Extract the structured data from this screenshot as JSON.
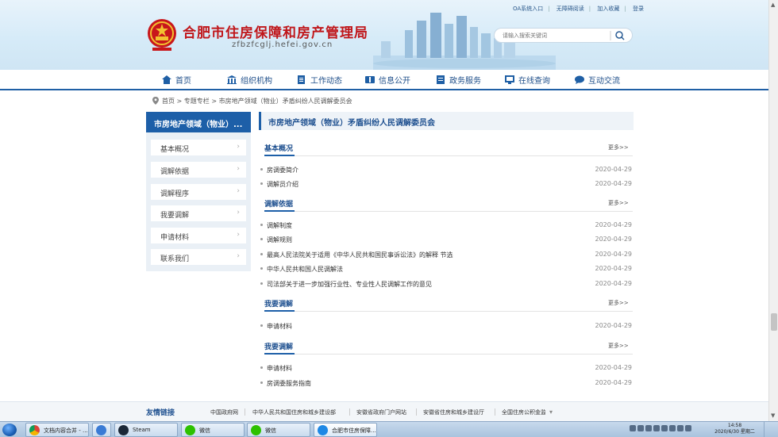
{
  "header": {
    "site_title": "合肥市住房保障和房产管理局",
    "site_domain": "zfbzfcglj.hefei.gov.cn",
    "top_links": [
      "OA系统入口",
      "无障碍阅读",
      "加入收藏",
      "登录"
    ],
    "search_placeholder": "请输入搜索关键词"
  },
  "nav": {
    "items": [
      {
        "label": "首页",
        "icon": "home-icon"
      },
      {
        "label": "组织机构",
        "icon": "building-icon"
      },
      {
        "label": "工作动态",
        "icon": "document-icon"
      },
      {
        "label": "信息公开",
        "icon": "info-icon"
      },
      {
        "label": "政务服务",
        "icon": "service-icon"
      },
      {
        "label": "在线查询",
        "icon": "query-icon"
      },
      {
        "label": "互动交流",
        "icon": "chat-icon"
      }
    ]
  },
  "breadcrumb": "首页 > 专题专栏 > 市房地产领域（物业）矛盾纠纷人民调解委员会",
  "sidebar": {
    "title": "市房地产领域（物业）...",
    "items": [
      "基本概况",
      "调解依据",
      "调解程序",
      "我要调解",
      "申请材料",
      "联系我们"
    ]
  },
  "main": {
    "title": "市房地产领域（物业）矛盾纠纷人民调解委员会",
    "more_label": "更多>>",
    "sections": [
      {
        "title": "基本概况",
        "items": [
          {
            "text": "房调委简介",
            "date": "2020-04-29"
          },
          {
            "text": "调解员介绍",
            "date": "2020-04-29"
          }
        ]
      },
      {
        "title": "调解依据",
        "items": [
          {
            "text": "调解制度",
            "date": "2020-04-29"
          },
          {
            "text": "调解规则",
            "date": "2020-04-29"
          },
          {
            "text": "最高人民法院关于适用《中华人民共和国民事诉讼法》的解释 节选",
            "date": "2020-04-29"
          },
          {
            "text": "中华人民共和国人民调解法",
            "date": "2020-04-29"
          },
          {
            "text": "司法部关于进一步加强行业性、专业性人民调解工作的意见",
            "date": "2020-04-29"
          }
        ]
      },
      {
        "title": "我要调解",
        "items": [
          {
            "text": "申请材料",
            "date": "2020-04-29"
          }
        ]
      },
      {
        "title": "我要调解",
        "items": [
          {
            "text": "申请材料",
            "date": "2020-04-29"
          },
          {
            "text": "房调委服务指南",
            "date": "2020-04-29"
          }
        ]
      }
    ]
  },
  "friends": {
    "label": "友情链接",
    "links": [
      "中国政府网",
      "中华人民共和国住房和城乡建设部",
      "安徽省政府门户网站",
      "安徽省住房和城乡建设厅",
      "全国住房公积金监管服务平台"
    ]
  },
  "taskbar": {
    "tasks": [
      "文档内容合并 - ...",
      "",
      "Steam",
      "微信",
      "微信",
      "合肥市住房保障..."
    ],
    "clock_time": "14:58",
    "clock_date": "2020/6/30 星期二"
  },
  "colors": {
    "brand_blue": "#1d5fa8",
    "title_red": "#c0161a"
  }
}
